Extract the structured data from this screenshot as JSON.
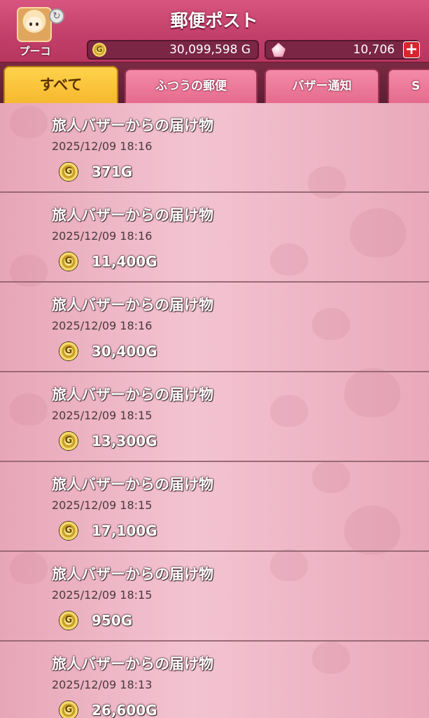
{
  "header": {
    "title": "郵便ポスト",
    "player_name": "プーコ",
    "gold": "30,099,598 G",
    "gems": "10,706",
    "coin_icon": "G",
    "plus_icon": "+"
  },
  "tabs": [
    {
      "label": "すべて",
      "active": true
    },
    {
      "label": "ふつうの郵便",
      "active": false
    },
    {
      "label": "バザー通知",
      "active": false
    },
    {
      "label": "S",
      "active": false
    }
  ],
  "mails": [
    {
      "title": "旅人バザーからの届け物",
      "date": "2025/12/09  18:16",
      "amount": "371G"
    },
    {
      "title": "旅人バザーからの届け物",
      "date": "2025/12/09  18:16",
      "amount": "11,400G"
    },
    {
      "title": "旅人バザーからの届け物",
      "date": "2025/12/09  18:16",
      "amount": "30,400G"
    },
    {
      "title": "旅人バザーからの届け物",
      "date": "2025/12/09  18:15",
      "amount": "13,300G"
    },
    {
      "title": "旅人バザーからの届け物",
      "date": "2025/12/09  18:15",
      "amount": "17,100G"
    },
    {
      "title": "旅人バザーからの届け物",
      "date": "2025/12/09  18:15",
      "amount": "950G"
    },
    {
      "title": "旅人バザーからの届け物",
      "date": "2025/12/09  18:13",
      "amount": "26,600G"
    }
  ]
}
